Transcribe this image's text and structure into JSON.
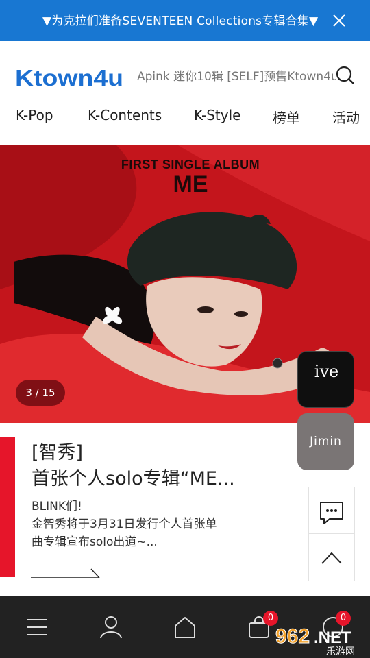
{
  "promo": {
    "text": "▼为克拉们准备SEVENTEEN Collections专辑合集▼"
  },
  "header": {
    "logo_text": "Ktown4u",
    "search_placeholder": "Apink 迷你10辑 [SELF]预售Ktown4u",
    "nav": [
      "K-Pop",
      "K-Contents",
      "K-Style",
      "榜单",
      "活动"
    ]
  },
  "hero": {
    "line1": "FIRST SINGLE ALBUM",
    "line2": "ME",
    "counter": "3 / 15"
  },
  "floating": {
    "ive_label": "ive",
    "jimin_label": "Jimin"
  },
  "card": {
    "title_line1": "[智秀]",
    "title_line2": "首张个人solo专辑“ME...",
    "body_line1": "BLINK们!",
    "body_line2": "金智秀将于3月31日发行个人首张单",
    "body_line3": "曲专辑宣布solo出道~..."
  },
  "bottom_nav": {
    "cart_badge": "0",
    "notify_badge": "0"
  },
  "watermark": {
    "text1": "962",
    "text2": ".NET",
    "text3": "乐游网"
  },
  "colors": {
    "promo_bg": "#1877d2",
    "logo_blue": "#1c6fd1",
    "accent_red": "#e6152a",
    "hero_red": "#b8161d",
    "bottom_bar": "#222222"
  }
}
